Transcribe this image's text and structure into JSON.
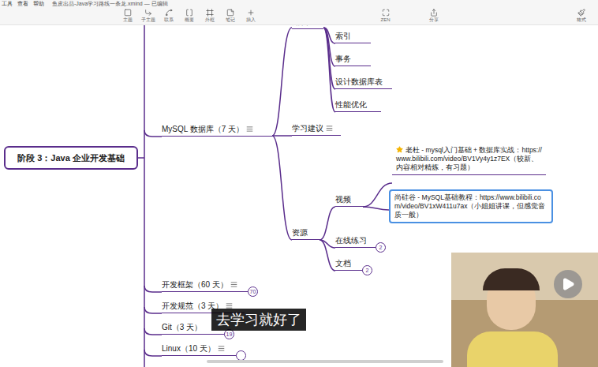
{
  "menu": [
    "工具",
    "查看",
    "帮助"
  ],
  "document_title": "鱼皮出品-Java学习路线一条龙.xmind — 已编辑",
  "toolbar": [
    "主题",
    "子主题",
    "联系",
    "概要",
    "外框",
    "笔记",
    "插入"
  ],
  "view_tools": [
    "ZEN",
    "分享",
    "格式"
  ],
  "mindmap": {
    "root": "阶段 3：Java 企业开发基础",
    "branches": [
      {
        "label": "MySQL 数据库（7 天）",
        "note": true,
        "collapsed": false,
        "badge": ""
      },
      {
        "label": "开发框架（60 天）",
        "note": true,
        "collapsed": true,
        "badge": "70"
      },
      {
        "label": "开发规范（3 天）",
        "note": true,
        "collapsed": false,
        "badge": ""
      },
      {
        "label": "Git（3 天）",
        "note": false,
        "collapsed": true,
        "badge": "19"
      },
      {
        "label": "Linux（10 天）",
        "note": true,
        "collapsed": true,
        "badge": ""
      }
    ],
    "mysql": {
      "knowledge": {
        "label": "知识",
        "items": [
          "索引",
          "事务",
          "设计数据库表",
          "性能优化"
        ]
      },
      "advice": {
        "label": "学习建议",
        "note": true
      },
      "resources": {
        "label": "资源",
        "children": [
          {
            "label": "视频",
            "badge": "",
            "cards": [
              {
                "text": "老杜 - mysql入门基础 + 数据库实战：https://www.bilibili.com/video/BV1Vy4y1z7EX（较新、内容相对精炼，有习题）",
                "starred": true,
                "selected": false
              },
              {
                "text": "尚硅谷 - MySQL基础教程：https://www.bilibili.com/video/BV1xW411u7ax（小姐姐讲课，但感觉音质一般）",
                "starred": false,
                "selected": true
              }
            ]
          },
          {
            "label": "在线练习",
            "badge": "2",
            "cards": []
          },
          {
            "label": "文档",
            "badge": "2",
            "cards": []
          }
        ]
      }
    }
  },
  "subtitle": "去学习就好了"
}
